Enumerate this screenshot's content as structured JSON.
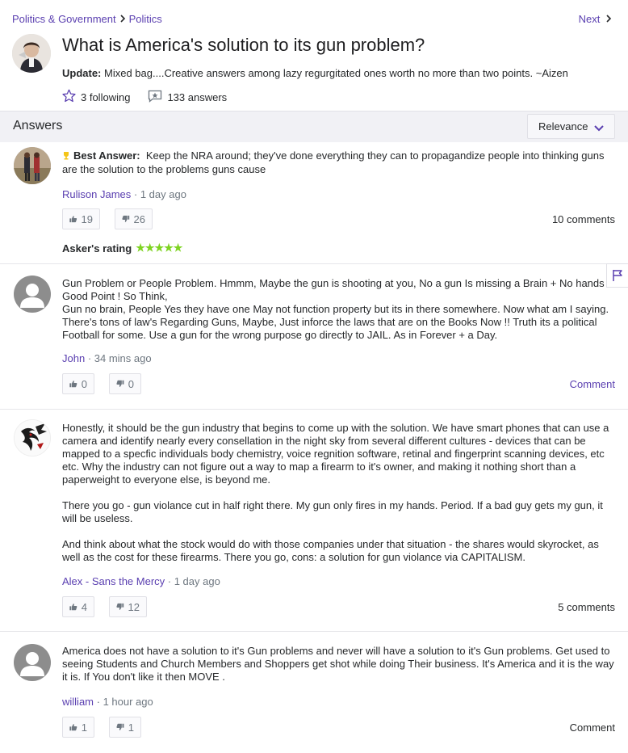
{
  "breadcrumb": {
    "category": "Politics & Government",
    "subcategory": "Politics"
  },
  "nav": {
    "next_label": "Next"
  },
  "question": {
    "title": "What is America's solution to its gun problem?",
    "update_label": "Update:",
    "update_text": "Mixed bag....Creative answers among lazy regurgitated ones worth no more than two points. ~Aizen",
    "following": "3 following",
    "answers_count": "133 answers"
  },
  "answers_section": {
    "title": "Answers",
    "sort_label": "Relevance"
  },
  "answers": [
    {
      "best_answer_label": "Best Answer:",
      "text": "Keep the NRA around; they've done everything they can to propagandize people into thinking guns are the solution to the problems guns cause",
      "author": "Rulison James",
      "time": "1 day ago",
      "upvotes": "19",
      "downvotes": "26",
      "comments": "10 comments",
      "rating_label": "Asker's rating",
      "rating_stars": "★★★★★"
    },
    {
      "text_lines": [
        "Gun Problem or People Problem. Hmmm, Maybe the gun is shooting at you, No a gun Is missing a Brain + No hands Good Point ! So Think,",
        "Gun no brain, People Yes they have one May not function property but its in there somewhere. Now what am I saying. There's tons of law's Regarding Guns, Maybe, Just inforce the laws that are on the Books Now !! Truth its a political Football for some. Use a gun for the wrong purpose go directly to JAIL. As in Forever + a Day."
      ],
      "author": "John",
      "time": "34 mins ago",
      "upvotes": "0",
      "downvotes": "0",
      "comments": "Comment"
    },
    {
      "paragraphs": [
        "Honestly, it should be the gun industry that begins to come up with the solution. We have smart phones that can use a camera and identify nearly every consellation in the night sky from several different cultures - devices that can be mapped to a specfic individuals body chemistry, voice regnition software, retinal and fingerprint scanning devices, etc etc. Why the industry can not figure out a way to map a firearm to it's owner, and making it nothing short than a paperweight to everyone else, is beyond me.",
        "There you go - gun violance cut in half right there. My gun only fires in my hands. Period. If a bad guy gets my gun, it will be useless.",
        "And think about what the stock would do with those companies under that situation - the shares would skyrocket, as well as the cost for these firearms. There you go, cons: a solution for gun violance via CAPITALISM."
      ],
      "author": "Alex - Sans the Mercy",
      "time": "1 day ago",
      "upvotes": "4",
      "downvotes": "12",
      "comments": "5 comments"
    },
    {
      "text": "America does not have a solution to it's Gun problems and never will have a solution to it's Gun problems. Get used to seeing Students and Church Members and Shoppers get shot while doing Their business. It's America and it is the way it is. If You don't like it then MOVE .",
      "author": "william",
      "time": "1 hour ago",
      "upvotes": "1",
      "downvotes": "1",
      "comments": "Comment"
    }
  ],
  "meta_separator": " · ",
  "icons": [
    "chevron-right-icon",
    "star-outline-icon",
    "answer-count-icon",
    "chevron-down-icon",
    "trophy-icon",
    "thumbs-up-icon",
    "thumbs-down-icon",
    "flag-icon",
    "default-avatar-icon"
  ],
  "colors": {
    "accent": "#5a3fb0",
    "star_green": "#7ed321",
    "trophy": "#f5c518"
  }
}
